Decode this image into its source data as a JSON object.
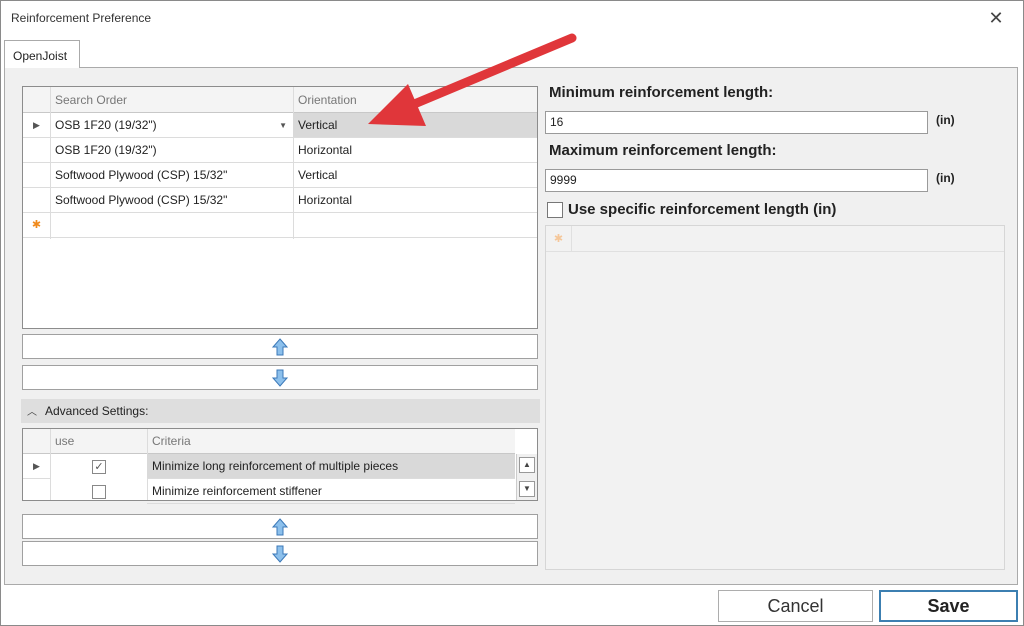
{
  "window": {
    "title": "Reinforcement Preference",
    "close_glyph": "✕"
  },
  "tabs": [
    {
      "label": "OpenJoist"
    }
  ],
  "search_grid": {
    "columns": [
      "Search Order",
      "Orientation"
    ],
    "rows": [
      {
        "search_order": "OSB 1F20 (19/32\")",
        "orientation": "Vertical",
        "selected": true
      },
      {
        "search_order": "OSB 1F20 (19/32\")",
        "orientation": "Horizontal"
      },
      {
        "search_order": "Softwood Plywood (CSP) 15/32\"",
        "orientation": "Vertical"
      },
      {
        "search_order": "Softwood Plywood (CSP) 15/32\"",
        "orientation": "Horizontal"
      }
    ],
    "new_row_glyph": "✱",
    "current_row_glyph": "▶"
  },
  "advanced": {
    "header": "Advanced Settings:",
    "columns": [
      "use",
      "Criteria"
    ],
    "rows": [
      {
        "checked": true,
        "criteria": "Minimize long reinforcement of multiple pieces"
      },
      {
        "checked": false,
        "criteria": "Minimize reinforcement stiffener"
      }
    ]
  },
  "reinforcement": {
    "min_label": "Minimum reinforcement length:",
    "min_value": "16",
    "max_label": "Maximum reinforcement length:",
    "max_value": "9999",
    "unit": "(in)",
    "specific_label": "Use specific reinforcement length (in)",
    "specific_checked": false
  },
  "footer": {
    "cancel_label": "Cancel",
    "save_label": "Save"
  },
  "colors": {
    "accent_blue": "#3c7fb1",
    "annotation_red": "#e0363a",
    "new_row_orange": "#f08a1c"
  }
}
